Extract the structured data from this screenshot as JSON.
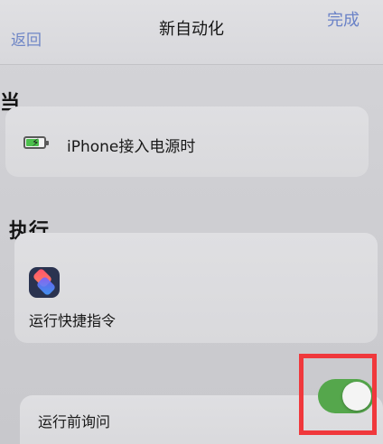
{
  "nav": {
    "back_label": "返回",
    "title": "新自动化",
    "done_label": "完成"
  },
  "when": {
    "heading": "当",
    "trigger_icon": "battery-charging-icon",
    "trigger_label": "iPhone接入电源时"
  },
  "do": {
    "heading": "执行",
    "action_icon": "shortcuts-icon",
    "action_label": "运行快捷指令"
  },
  "ask": {
    "label": "运行前询问",
    "toggle_on": true
  },
  "colors": {
    "accent": "#6a82c7",
    "toggle_on": "#55a74c",
    "highlight": "#f0383c"
  }
}
